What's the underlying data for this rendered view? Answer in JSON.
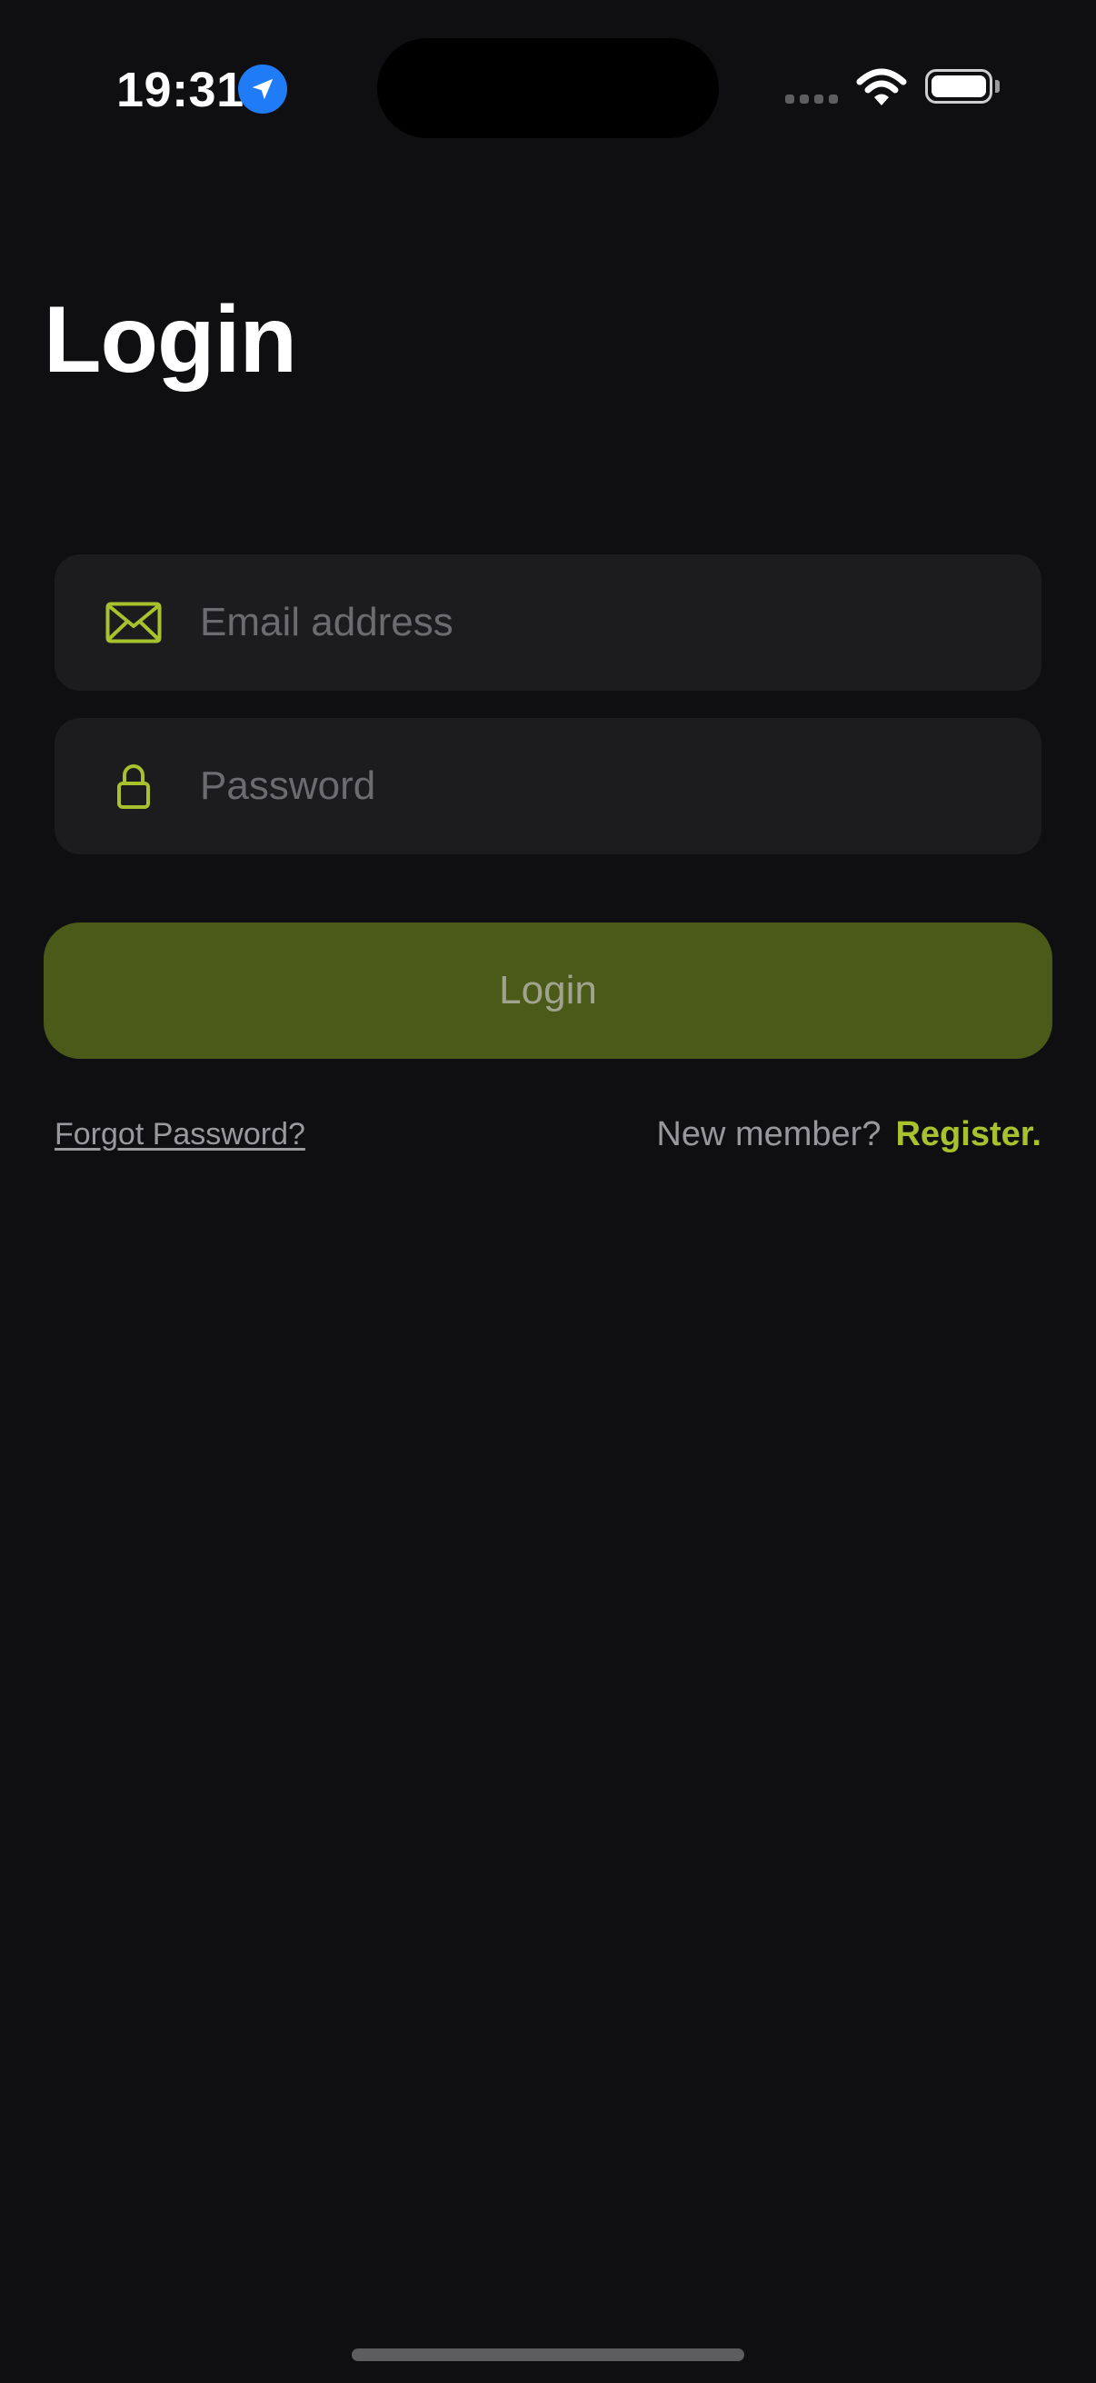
{
  "status_bar": {
    "time": "19:31"
  },
  "screen": {
    "title": "Login"
  },
  "form": {
    "email": {
      "placeholder": "Email address",
      "value": "",
      "icon": "envelope-icon"
    },
    "password": {
      "placeholder": "Password",
      "value": "",
      "icon": "lock-icon"
    },
    "submit_label": "Login"
  },
  "links": {
    "forgot_password": "Forgot Password?",
    "new_member": "New member?",
    "register": "Register."
  },
  "colors": {
    "background": "#0f0f11",
    "field_background": "#1c1c1e",
    "accent": "#a8c22e",
    "button_background": "#4b5a18",
    "location_badge": "#1f7cf6"
  }
}
